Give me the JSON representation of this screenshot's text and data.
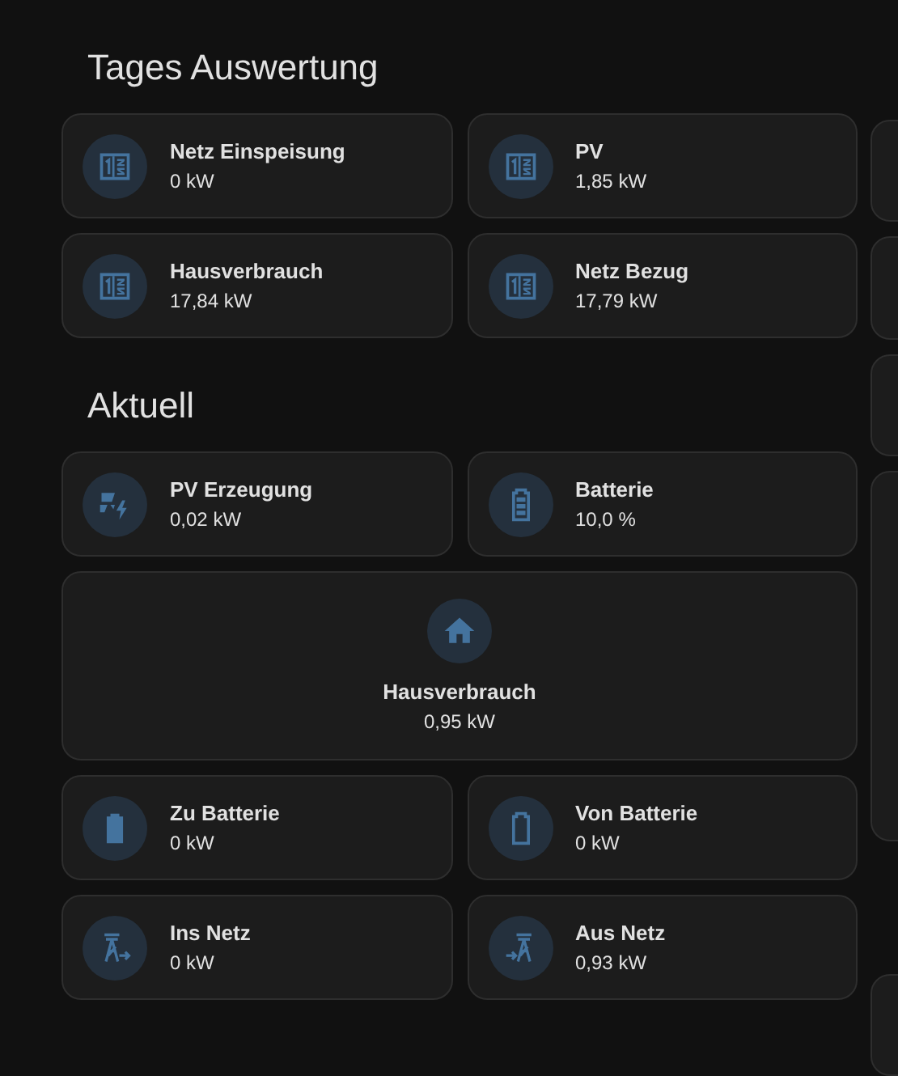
{
  "sections": [
    {
      "title": "Tages Auswertung",
      "tiles": [
        {
          "name": "Netz Einspeisung",
          "state": "0 kW",
          "kind": "meter"
        },
        {
          "name": "PV",
          "state": "1,85 kW",
          "kind": "meter"
        },
        {
          "name": "Hausverbrauch",
          "state": "17,84 kW",
          "kind": "meter"
        },
        {
          "name": "Netz Bezug",
          "state": "17,79 kW",
          "kind": "meter"
        }
      ]
    },
    {
      "title": "Aktuell",
      "tiles": [
        {
          "name": "PV Erzeugung",
          "state": "0,02 kW",
          "kind": "solar"
        },
        {
          "name": "Batterie",
          "state": "10,0 %",
          "kind": "battery"
        },
        {
          "name": "Hausverbrauch",
          "state": "0,95 kW",
          "kind": "home"
        },
        {
          "name": "Zu Batterie",
          "state": "0 kW",
          "kind": "charge"
        },
        {
          "name": "Von Batterie",
          "state": "0 kW",
          "kind": "discharge"
        },
        {
          "name": "Ins Netz",
          "state": "0 kW",
          "kind": "export"
        },
        {
          "name": "Aus Netz",
          "state": "0,93 kW",
          "kind": "import"
        }
      ]
    }
  ]
}
